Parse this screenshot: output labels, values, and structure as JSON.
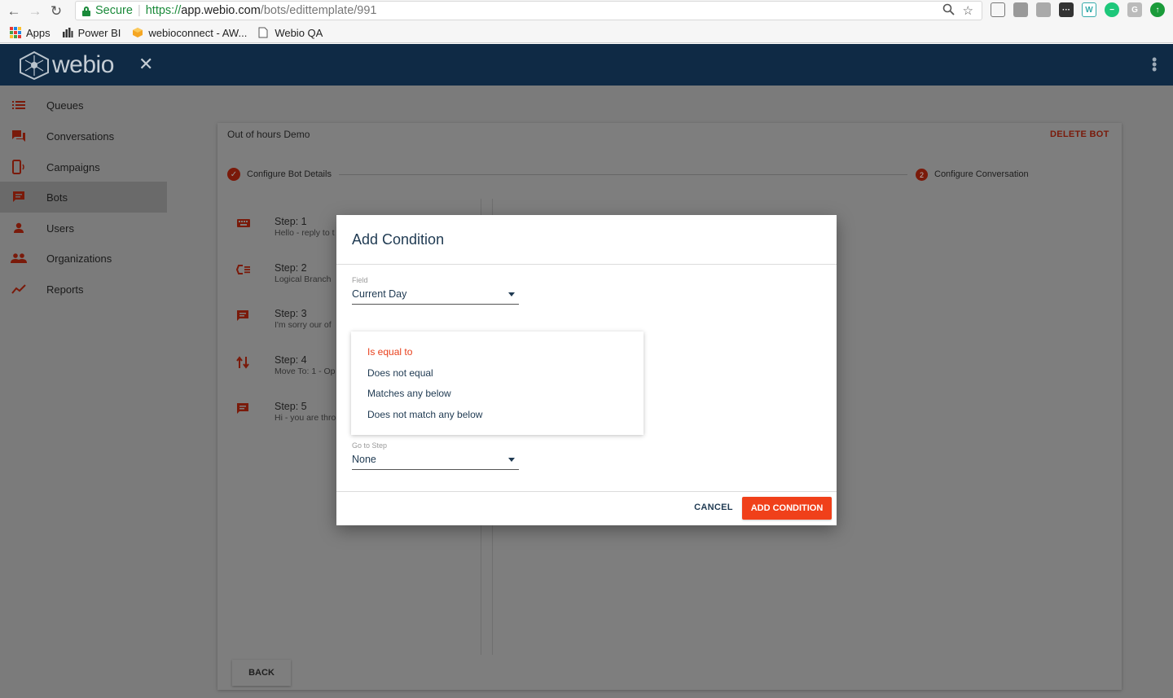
{
  "browser": {
    "secure_label": "Secure",
    "url_scheme": "https://",
    "url_host": "app.webio.com",
    "url_path": "/bots/edittemplate/991"
  },
  "bookmarks": [
    {
      "label": "Apps",
      "icon": "apps-grid-icon"
    },
    {
      "label": "Power BI",
      "icon": "chart-icon"
    },
    {
      "label": "webioconnect - AW...",
      "icon": "aws-cube-icon"
    },
    {
      "label": "Webio QA",
      "icon": "page-icon"
    }
  ],
  "header": {
    "logo_text": "webio",
    "close_symbol": "✕",
    "menu_symbol": "⋮"
  },
  "sidebar": {
    "items": [
      {
        "label": "Queues",
        "icon": "list-icon"
      },
      {
        "label": "Conversations",
        "icon": "chat-bubbles-icon"
      },
      {
        "label": "Campaigns",
        "icon": "phone-broadcast-icon"
      },
      {
        "label": "Bots",
        "icon": "message-icon"
      },
      {
        "label": "Users",
        "icon": "person-icon"
      },
      {
        "label": "Organizations",
        "icon": "people-icon"
      },
      {
        "label": "Reports",
        "icon": "trend-icon"
      }
    ],
    "active": "Bots"
  },
  "card": {
    "title": "Out of hours Demo",
    "delete_label": "DELETE BOT",
    "stepper": {
      "step1_label": "Configure Bot Details",
      "step2_number": "2",
      "step2_label": "Configure Conversation"
    },
    "steps": [
      {
        "title": "Step: 1",
        "subtitle": "Hello - reply to t",
        "icon": "keyboard-icon"
      },
      {
        "title": "Step: 2",
        "subtitle": "Logical Branch",
        "icon": "branch-icon"
      },
      {
        "title": "Step: 3",
        "subtitle": "I'm sorry our of",
        "icon": "message-icon"
      },
      {
        "title": "Step: 4",
        "subtitle": "Move To: 1 - Op",
        "icon": "swap-icon"
      },
      {
        "title": "Step: 5",
        "subtitle": "Hi - you are thro",
        "icon": "message-icon"
      }
    ],
    "back_label": "BACK"
  },
  "dialog": {
    "title": "Add Condition",
    "field_label": "Field",
    "field_value": "Current Day",
    "operator_options": [
      "Is equal to",
      "Does not equal",
      "Matches any below",
      "Does not match any below"
    ],
    "operator_selected": "Is equal to",
    "goto_label": "Go to Step",
    "goto_value": "None",
    "cancel_label": "CANCEL",
    "add_label": "ADD CONDITION"
  },
  "colors": {
    "header_bg": "#0f2a45",
    "accent": "#f0401a",
    "dialog_text": "#1f3a52"
  }
}
